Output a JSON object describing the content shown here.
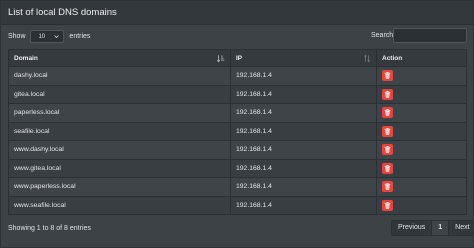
{
  "header": {
    "title": "List of local DNS domains"
  },
  "length_control": {
    "prefix": "Show",
    "selected": "10",
    "suffix": "entries"
  },
  "search": {
    "label": "Search:",
    "value": "",
    "placeholder": ""
  },
  "table": {
    "columns": [
      "Domain",
      "IP",
      "Action"
    ],
    "rows": [
      {
        "domain": "dashy.local",
        "ip": "192.168.1.4"
      },
      {
        "domain": "gitea.local",
        "ip": "192.168.1.4"
      },
      {
        "domain": "paperless.local",
        "ip": "192.168.1.4"
      },
      {
        "domain": "seafile.local",
        "ip": "192.168.1.4"
      },
      {
        "domain": "www.dashy.local",
        "ip": "192.168.1.4"
      },
      {
        "domain": "www.gitea.local",
        "ip": "192.168.1.4"
      },
      {
        "domain": "www.paperless.local",
        "ip": "192.168.1.4"
      },
      {
        "domain": "www.seafile.local",
        "ip": "192.168.1.4"
      }
    ],
    "action_icon": "trash-icon"
  },
  "footer": {
    "info": "Showing 1 to 8 of 8 entries",
    "pagination": {
      "previous": "Previous",
      "current": "1",
      "next": "Next"
    }
  },
  "colors": {
    "delete_button": "#e8443a",
    "card_background": "#3d4247",
    "header_background": "#33383c"
  }
}
